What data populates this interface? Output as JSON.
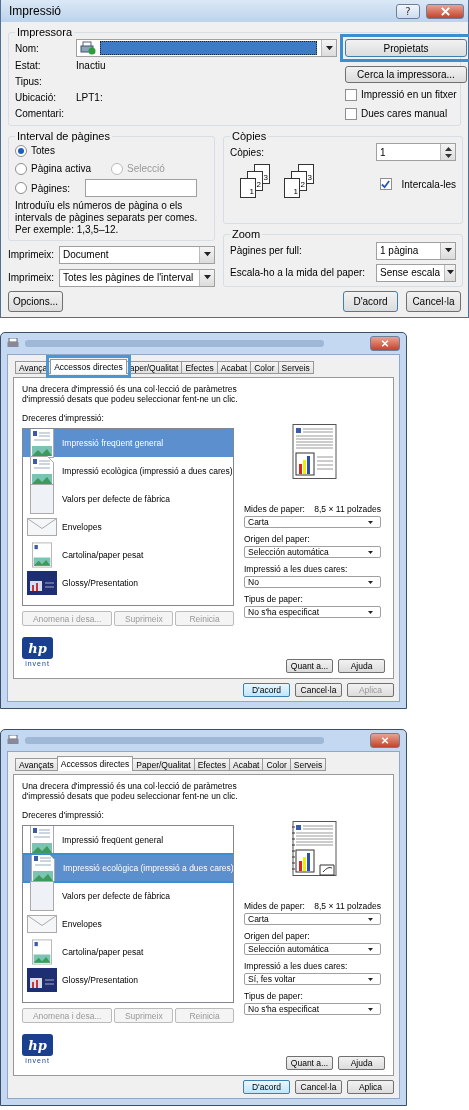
{
  "print_dialog": {
    "title": "Impressió",
    "help_button": "?",
    "printer": {
      "legend": "Impressora",
      "fields": [
        {
          "kind": "select",
          "label": "Nom:"
        },
        {
          "kind": "text",
          "label": "Estat:",
          "value": "Inactiu"
        },
        {
          "kind": "text",
          "label": "Tipus:"
        },
        {
          "kind": "text",
          "label": "Ubicació:",
          "value": "LPT1:"
        },
        {
          "kind": "text",
          "label": "Comentari:"
        }
      ],
      "properties_button": {
        "label": "Propietats",
        "highlighted": true
      },
      "find_button": "Cerca la impressora...",
      "checkboxes": [
        {
          "label": "Impressió en un fitxer",
          "checked": false
        },
        {
          "label": "Dues cares manual",
          "checked": false
        }
      ]
    },
    "range": {
      "legend": "Interval de pàgines",
      "options": [
        {
          "label": "Totes",
          "selected": true,
          "disabled": false
        },
        {
          "label": "Pàgina activa",
          "selected": false,
          "disabled": false
        },
        {
          "label": "Selecció",
          "selected": false,
          "disabled": true
        },
        {
          "label": "Pàgines:",
          "selected": false,
          "disabled": false
        }
      ],
      "help": "Introduïu els números de pàgina o els intervals de pàgines separats per comes. Per exemple: 1,3,5–12."
    },
    "copies": {
      "legend": "Còpies",
      "label": "Còpies:",
      "value": "1",
      "stacks": [
        [
          "3",
          "2",
          "1"
        ],
        [
          "3",
          "2",
          "1"
        ]
      ],
      "collate": {
        "label": "Intercala-les",
        "checked": true
      }
    },
    "print_what": [
      {
        "label": "Imprimeix:",
        "value": "Document"
      },
      {
        "label": "Imprimeix:",
        "value": "Totes les pàgines de l'interval"
      }
    ],
    "zoom": {
      "legend": "Zoom",
      "rows": [
        {
          "label": "Pàgines per full:",
          "value": "1 pàgina"
        },
        {
          "label": "Escala-ho a la mida del paper:",
          "value": "Sense escala"
        }
      ]
    },
    "options_button": "Opcions...",
    "ok_button": "D'acord",
    "cancel_button": "Cancel·la"
  },
  "preferences_dialogs": [
    {
      "tabs": [
        {
          "label": "Avança",
          "selected": false,
          "highlighted": false
        },
        {
          "label": "Accessos directes",
          "selected": true,
          "highlighted": true
        },
        {
          "label": "aper/Qualitat",
          "selected": false,
          "highlighted": false
        },
        {
          "label": "Efectes",
          "selected": false,
          "highlighted": false
        },
        {
          "label": "Acabat",
          "selected": false,
          "highlighted": false
        },
        {
          "label": "Color",
          "selected": false,
          "highlighted": false
        },
        {
          "label": "Serveis",
          "selected": false,
          "highlighted": false
        }
      ],
      "intro": "Una drecera d'impressió és una col·lecció de paràmetres d'impressió desats que podeu seleccionar fent-ne un clic.",
      "list_label": "Dreceres d'impressió:",
      "shortcuts": [
        {
          "kind": "document",
          "label": "Impressió freqüent general",
          "selected": true,
          "highlighted": false
        },
        {
          "kind": "eco",
          "label": "Impressió ecològica (impressió a dues cares)",
          "selected": false,
          "highlighted": false
        },
        {
          "kind": "blank",
          "label": "Valors per defecte de fàbrica",
          "selected": false,
          "highlighted": false
        },
        {
          "kind": "envelope",
          "label": "Envelopes",
          "selected": false,
          "highlighted": false
        },
        {
          "kind": "cardstock",
          "label": "Cartolina/paper pesat",
          "selected": false,
          "highlighted": false
        },
        {
          "kind": "glossy",
          "label": "Glossy/Presentation",
          "selected": false,
          "highlighted": false
        }
      ],
      "preview": {
        "kind": "simplex"
      },
      "settings": [
        {
          "label": "Mides de paper:",
          "reading": "8,5 × 11 polzades",
          "value": "Carta"
        },
        {
          "label": "Origen del paper:",
          "value": "Selección automática"
        },
        {
          "label": "Impressió a les dues cares:",
          "value": "No"
        },
        {
          "label": "Tipus de paper:",
          "value": "No s'ha especificat"
        }
      ],
      "list_buttons": [
        "Anomena i desa...",
        "Suprimeix",
        "Reinicia"
      ],
      "logo": {
        "mark": "hp",
        "tagline": "invent"
      },
      "about_button": "Quant a...",
      "help_button": "Ajuda",
      "ok_button": "D'acord",
      "cancel_button": "Cancel·la",
      "apply_button": {
        "label": "Aplica",
        "disabled": true
      }
    },
    {
      "tabs": [
        {
          "label": "Avançats",
          "selected": false,
          "highlighted": false
        },
        {
          "label": "Accessos directes",
          "selected": true,
          "highlighted": false
        },
        {
          "label": "Paper/Qualitat",
          "selected": false,
          "highlighted": false
        },
        {
          "label": "Efectes",
          "selected": false,
          "highlighted": false
        },
        {
          "label": "Acabat",
          "selected": false,
          "highlighted": false
        },
        {
          "label": "Color",
          "selected": false,
          "highlighted": false
        },
        {
          "label": "Serveis",
          "selected": false,
          "highlighted": false
        }
      ],
      "intro": "Una drecera d'impressió és una col·lecció de paràmetres d'impressió desats que podeu seleccionar fent-ne un clic.",
      "list_label": "Dreceres d'impressió:",
      "shortcuts": [
        {
          "kind": "document",
          "label": "Impressió freqüent general",
          "selected": false,
          "highlighted": false
        },
        {
          "kind": "eco",
          "label": "Impressió ecològica (impressió a dues cares)",
          "selected": true,
          "highlighted": true
        },
        {
          "kind": "blank",
          "label": "Valors per defecte de fàbrica",
          "selected": false,
          "highlighted": false
        },
        {
          "kind": "envelope",
          "label": "Envelopes",
          "selected": false,
          "highlighted": false
        },
        {
          "kind": "cardstock",
          "label": "Cartolina/paper pesat",
          "selected": false,
          "highlighted": false
        },
        {
          "kind": "glossy",
          "label": "Glossy/Presentation",
          "selected": false,
          "highlighted": false
        }
      ],
      "preview": {
        "kind": "duplex"
      },
      "settings": [
        {
          "label": "Mides de paper:",
          "reading": "8,5 × 11 polzades",
          "value": "Carta"
        },
        {
          "label": "Origen del paper:",
          "value": "Selección automática"
        },
        {
          "label": "Impressió a les dues cares:",
          "value": "Sí, fes voltar"
        },
        {
          "label": "Tipus de paper:",
          "value": "No s'ha especificat"
        }
      ],
      "list_buttons": [
        "Anomena i desa...",
        "Suprimeix",
        "Reinicia"
      ],
      "logo": {
        "mark": "hp",
        "tagline": "invent"
      },
      "about_button": "Quant a...",
      "help_button": "Ajuda",
      "ok_button": "D'acord",
      "cancel_button": "Cancel·la",
      "apply_button": {
        "label": "Aplica",
        "disabled": false
      }
    }
  ]
}
